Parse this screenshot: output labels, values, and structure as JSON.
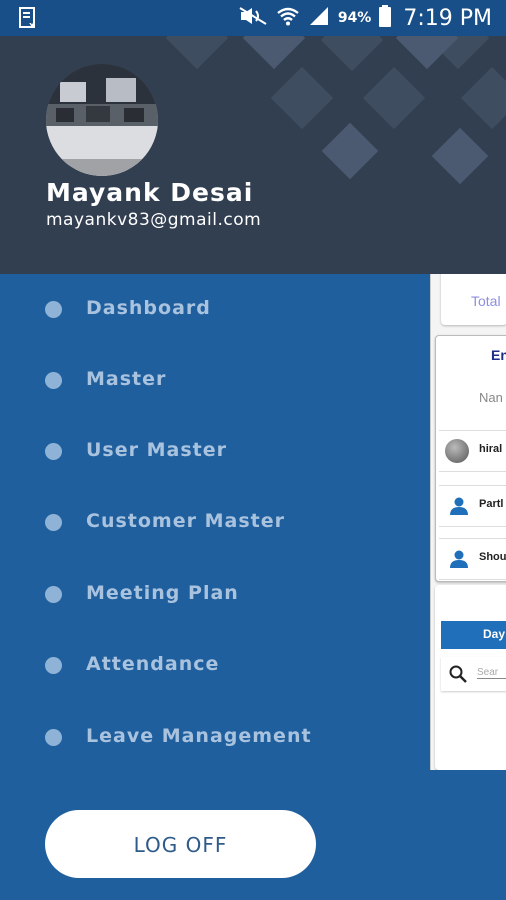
{
  "status_bar": {
    "time": "7:19 PM",
    "battery": "94%",
    "icons": [
      "app-notification-icon",
      "mute-icon",
      "wifi-icon",
      "signal-icon",
      "battery-icon"
    ]
  },
  "drawer": {
    "profile": {
      "name": "Mayank Desai",
      "email": "mayankv83@gmail.com"
    },
    "menu_items": [
      {
        "label": "Dashboard"
      },
      {
        "label": "Master"
      },
      {
        "label": "User Master"
      },
      {
        "label": "Customer Master"
      },
      {
        "label": "Meeting Plan"
      },
      {
        "label": "Attendance"
      },
      {
        "label": "Leave Management"
      }
    ],
    "logoff_label": "LOG OFF"
  },
  "background_app": {
    "total_label": "Total",
    "entry_label": "En",
    "name_label": "Nan",
    "rows": [
      "hiral",
      "Partl",
      "Shou"
    ],
    "tab_label": "Day",
    "search_placeholder": "Sear"
  },
  "colors": {
    "drawer_bg": "#1f5f9e",
    "header_bg": "#323f51",
    "status_bar": "#184f88",
    "menu_text": "#a9c3df",
    "toolbar": "#1f6fba"
  }
}
